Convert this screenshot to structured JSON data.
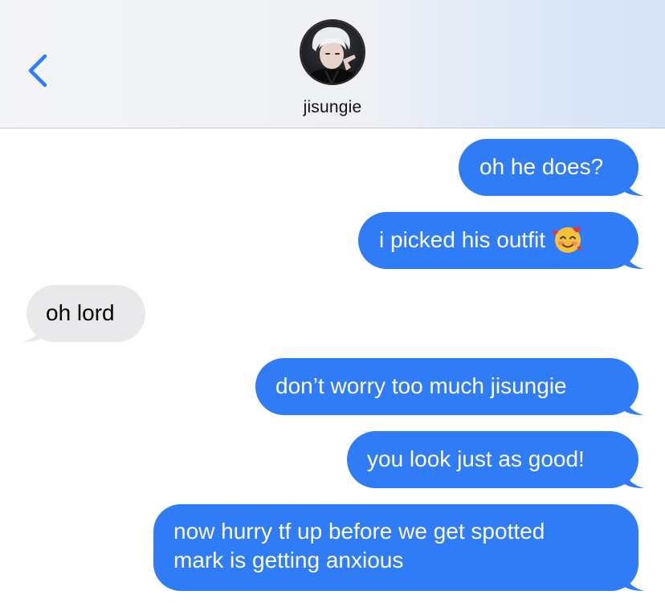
{
  "header": {
    "contact_name": "jisungie",
    "back_icon": "chevron-left-icon",
    "avatar": "contact-avatar"
  },
  "colors": {
    "sent_bubble": "#2f7cf6",
    "received_bubble": "#e9e9eb",
    "accent": "#2f7cf6"
  },
  "messages": [
    {
      "direction": "sent",
      "text": "oh he does?"
    },
    {
      "direction": "sent",
      "text": "i picked his outfit",
      "emoji": "smiling-face-with-hearts-emoji"
    },
    {
      "direction": "received",
      "text": "oh lord"
    },
    {
      "direction": "sent",
      "text": "don’t worry too much jisungie"
    },
    {
      "direction": "sent",
      "text": "you look just as good!"
    },
    {
      "direction": "sent",
      "lines": [
        "now hurry tf up before we get spotted",
        "mark is getting anxious"
      ]
    }
  ]
}
